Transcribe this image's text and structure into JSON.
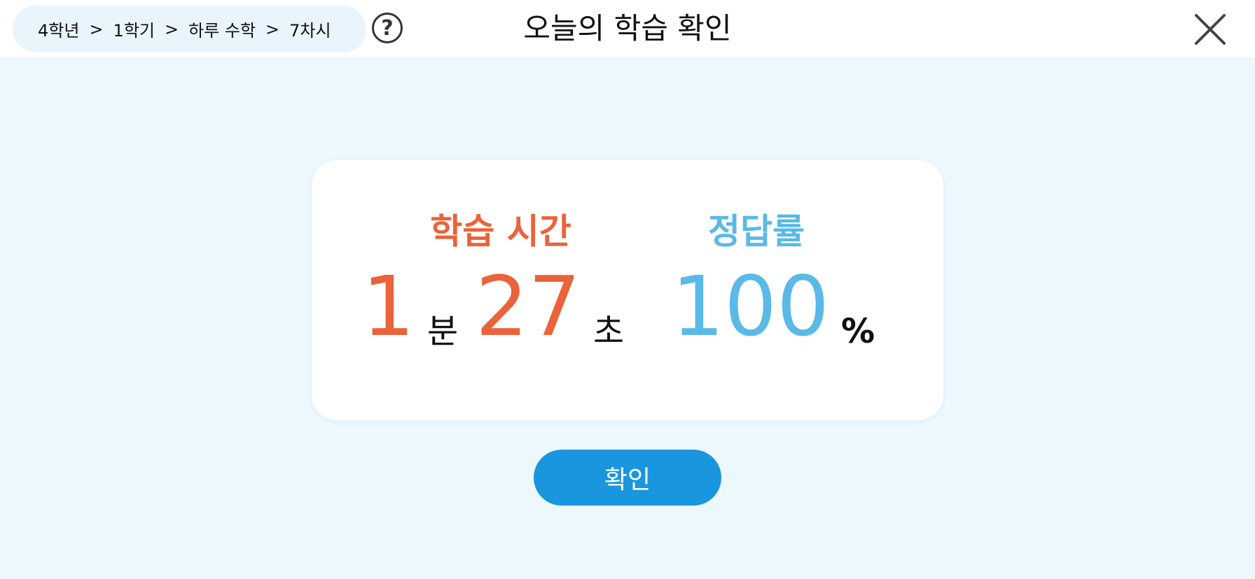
{
  "header": {
    "breadcrumb": [
      "4학년",
      "1학기",
      "하루 수학",
      "7차시"
    ],
    "breadcrumb_separator": ">",
    "help_label": "?",
    "title": "오늘의 학습 확인"
  },
  "result": {
    "time_label": "학습 시간",
    "minutes": "1",
    "minutes_unit": "분",
    "seconds": "27",
    "seconds_unit": "초",
    "accuracy_label": "정답률",
    "accuracy": "100",
    "accuracy_unit": "%"
  },
  "confirm_label": "확인",
  "icons": {
    "help": "question-circle-icon",
    "close": "close-x-icon"
  },
  "colors": {
    "time_accent": "#ea633a",
    "accuracy_accent": "#5ab9e7",
    "button": "#1996dd",
    "background": "#ecf7fe"
  }
}
